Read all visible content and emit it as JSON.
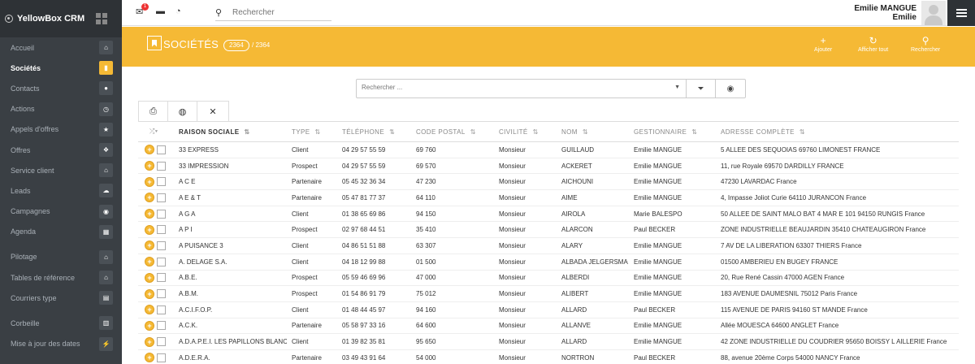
{
  "app": {
    "brand": "YellowBox CRM"
  },
  "sidebar": {
    "items": [
      {
        "label": "Accueil",
        "icon": "home-icon",
        "glyph": "⌂",
        "active": false
      },
      {
        "label": "Sociétés",
        "icon": "bookmark-icon",
        "glyph": "▮",
        "active": true
      },
      {
        "label": "Contacts",
        "icon": "users-icon",
        "glyph": "●",
        "active": false
      },
      {
        "label": "Actions",
        "icon": "clock-icon",
        "glyph": "◷",
        "active": false
      },
      {
        "label": "Appels d'offres",
        "icon": "star-icon",
        "glyph": "★",
        "active": false
      },
      {
        "label": "Offres",
        "icon": "handshake-icon",
        "glyph": "❖",
        "active": false
      },
      {
        "label": "Service client",
        "icon": "home-icon",
        "glyph": "⌂",
        "active": false
      },
      {
        "label": "Leads",
        "icon": "cloud-icon",
        "glyph": "☁",
        "active": false
      },
      {
        "label": "Campagnes",
        "icon": "target-icon",
        "glyph": "◉",
        "active": false
      },
      {
        "label": "Agenda",
        "icon": "calendar-icon",
        "glyph": "▦",
        "active": false
      }
    ],
    "items2": [
      {
        "label": "Pilotage",
        "icon": "home-icon",
        "glyph": "⌂"
      },
      {
        "label": "Tables de référence",
        "icon": "home-icon",
        "glyph": "⌂"
      },
      {
        "label": "Courriers type",
        "icon": "clipboard-icon",
        "glyph": "▤"
      }
    ],
    "items3": [
      {
        "label": "Corbeille",
        "icon": "trash-icon",
        "glyph": "▥"
      },
      {
        "label": "Mise à jour des dates",
        "icon": "bolt-icon",
        "glyph": "⚡"
      }
    ]
  },
  "topbar": {
    "badge_count": "1",
    "search_placeholder": "Rechercher",
    "user_first": "Emilie MANGUE",
    "user_second": "Emilie"
  },
  "header": {
    "title": "SOCIÉTÉS",
    "count": "2364",
    "total": "/ 2364",
    "actions": [
      {
        "label": "Ajouter",
        "glyph": "+"
      },
      {
        "label": "Afficher tout",
        "glyph": "↻"
      },
      {
        "label": "Rechercher",
        "glyph": "⚲"
      }
    ]
  },
  "filter": {
    "placeholder": "Rechercher ..."
  },
  "table": {
    "columns": [
      "RAISON SOCIALE",
      "TYPE",
      "TÉLÉPHONE",
      "CODE POSTAL",
      "CIVILITÉ",
      "NOM",
      "GESTIONNAIRE",
      "ADRESSE COMPLÈTE"
    ],
    "rows": [
      [
        "33 EXPRESS",
        "Client",
        "04 29 57 55 59",
        "69 760",
        "Monsieur",
        "GUILLAUD",
        "Emilie MANGUE",
        "5 ALLEE DES SEQUOIAS 69760 LIMONEST FRANCE"
      ],
      [
        "33 IMPRESSION",
        "Prospect",
        "04 29 57 55 59",
        "69 570",
        "Monsieur",
        "ACKERET",
        "Emilie MANGUE",
        "11, rue Royale 69570 DARDILLY FRANCE"
      ],
      [
        "A C E",
        "Partenaire",
        "05 45 32 36 34",
        "47 230",
        "Monsieur",
        "AICHOUNI",
        "Emilie MANGUE",
        "47230 LAVARDAC France"
      ],
      [
        "A E & T",
        "Partenaire",
        "05 47 81 77 37",
        "64 110",
        "Monsieur",
        "AIME",
        "Emilie MANGUE",
        "4, Impasse Joliot Curie 64110 JURANCON France"
      ],
      [
        "A G A",
        "Client",
        "01 38 65 69 86",
        "94 150",
        "Monsieur",
        "AIROLA",
        "Marie BALESPO",
        "50 ALLEE DE SAINT MALO BAT 4 MAR E 101 94150 RUNGIS France"
      ],
      [
        "A P I",
        "Prospect",
        "02 97 68 44 51",
        "35 410",
        "Monsieur",
        "ALARCON",
        "Paul BECKER",
        "ZONE INDUSTRIELLE BEAUJARDIN 35410 CHATEAUGIRON France"
      ],
      [
        "A PUISANCE 3",
        "Client",
        "04 86 51 51 88",
        "63 307",
        "Monsieur",
        "ALARY",
        "Emilie MANGUE",
        "7 AV DE LA LIBERATION 63307 THIERS France"
      ],
      [
        "A. DELAGE S.A.",
        "Client",
        "04 18 12 99 88",
        "01 500",
        "Monsieur",
        "ALBADA JELGERSMA",
        "Emilie MANGUE",
        "01500 AMBERIEU EN BUGEY FRANCE"
      ],
      [
        "A.B.E.",
        "Prospect",
        "05 59 46 69 96",
        "47 000",
        "Monsieur",
        "ALBERDI",
        "Emilie MANGUE",
        "20, Rue René Cassin 47000 AGEN France"
      ],
      [
        "A.B.M.",
        "Prospect",
        "01 54 86 91 79",
        "75 012",
        "Monsieur",
        "ALIBERT",
        "Emilie MANGUE",
        "183 AVENUE DAUMESNIL 75012 Paris France"
      ],
      [
        "A.C.I.F.O.P.",
        "Client",
        "01 48 44 45 97",
        "94 160",
        "Monsieur",
        "ALLARD",
        "Paul BECKER",
        "115 AVENUE DE PARIS 94160 ST MANDE France"
      ],
      [
        "A.C.K.",
        "Partenaire",
        "05 58 97 33 16",
        "64 600",
        "Monsieur",
        "ALLANVE",
        "Emilie MANGUE",
        "Allée MOUESCA 64600 ANGLET France"
      ],
      [
        "A.D.A.P.E.I. LES PAPILLONS BLANC",
        "Client",
        "01 39 82 35 81",
        "95 650",
        "Monsieur",
        "ALLARD",
        "Emilie MANGUE",
        "42 ZONE INDUSTRIELLE DU COUDRIER 95650 BOISSY L AILLERIE France"
      ],
      [
        "A.D.E.R.A.",
        "Partenaire",
        "03 49 43 91 64",
        "54 000",
        "Monsieur",
        "NORTRON",
        "Paul BECKER",
        "88, avenue 20ème Corps 54000 NANCY France"
      ]
    ]
  }
}
